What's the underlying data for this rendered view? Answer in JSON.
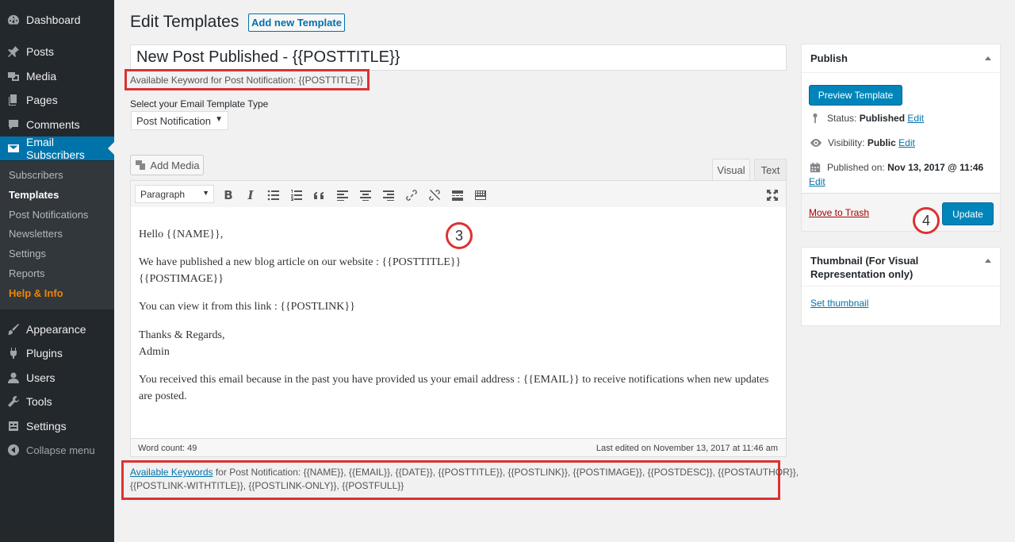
{
  "sidebar": {
    "menu": [
      {
        "label": "Dashboard",
        "icon": "dashboard-icon"
      },
      {
        "label": "Posts",
        "icon": "pin-icon"
      },
      {
        "label": "Media",
        "icon": "media-icon"
      },
      {
        "label": "Pages",
        "icon": "pages-icon"
      },
      {
        "label": "Comments",
        "icon": "comment-icon"
      },
      {
        "label": "Email Subscribers",
        "icon": "envelope-icon"
      },
      {
        "label": "Appearance",
        "icon": "brush-icon"
      },
      {
        "label": "Plugins",
        "icon": "plug-icon"
      },
      {
        "label": "Users",
        "icon": "user-icon"
      },
      {
        "label": "Tools",
        "icon": "wrench-icon"
      },
      {
        "label": "Settings",
        "icon": "settings-icon"
      }
    ],
    "submenu": [
      "Subscribers",
      "Templates",
      "Post Notifications",
      "Newsletters",
      "Settings",
      "Reports",
      "Help & Info"
    ],
    "collapse_label": "Collapse menu"
  },
  "header": {
    "title": "Edit Templates",
    "add_new_label": "Add new Template"
  },
  "form": {
    "post_title": "New Post Published - {{POSTTITLE}}",
    "keyword_hint": "Available Keyword for Post Notification: {{POSTTITLE}}",
    "template_type_label": "Select your Email Template Type",
    "template_type_value": "Post Notification"
  },
  "editor": {
    "add_media_label": "Add Media",
    "tab_visual": "Visual",
    "tab_text": "Text",
    "format_select": "Paragraph",
    "content": {
      "p1": "Hello {{NAME}},",
      "p2_line1": "We have published a new blog article on our website : {{POSTTITLE}}",
      "p2_line2": "{{POSTIMAGE}}",
      "p3": "You can view it from this link : {{POSTLINK}}",
      "p4_line1": "Thanks & Regards,",
      "p4_line2": "Admin",
      "p5_line1": "You received this email because in the past you have provided us your email address : {{EMAIL}} to receive notifications when new updates",
      "p5_line2": "are posted."
    },
    "word_count": "Word count: 49",
    "last_edited": "Last edited on November 13, 2017 at 11:46 am"
  },
  "keywords": {
    "link_label": "Available Keywords",
    "line1_rest": " for Post Notification: {{NAME}}, {{EMAIL}}, {{DATE}}, {{POSTTITLE}}, {{POSTLINK}}, {{POSTIMAGE}}, {{POSTDESC}}, {{POSTAUTHOR}},",
    "line2": "{{POSTLINK-WITHTITLE}}, {{POSTLINK-ONLY}}, {{POSTFULL}}"
  },
  "annotations": {
    "step3": "3",
    "step4": "4"
  },
  "publish_box": {
    "title": "Publish",
    "preview_label": "Preview Template",
    "status_label": "Status:",
    "status_value": "Published",
    "visibility_label": "Visibility:",
    "visibility_value": "Public",
    "published_label": "Published on:",
    "published_value": "Nov 13, 2017 @ 11:46",
    "edit_label": "Edit",
    "trash_label": "Move to Trash",
    "update_label": "Update"
  },
  "thumbnail_box": {
    "title_line1": "Thumbnail (For Visual",
    "title_line2": "Representation only)",
    "set_label": "Set thumbnail"
  },
  "colors": {
    "sidebar_bg": "#23282d",
    "accent": "#0073aa",
    "primary_button": "#0085ba",
    "highlight_red": "#dc3232",
    "help_orange": "#f18500"
  }
}
